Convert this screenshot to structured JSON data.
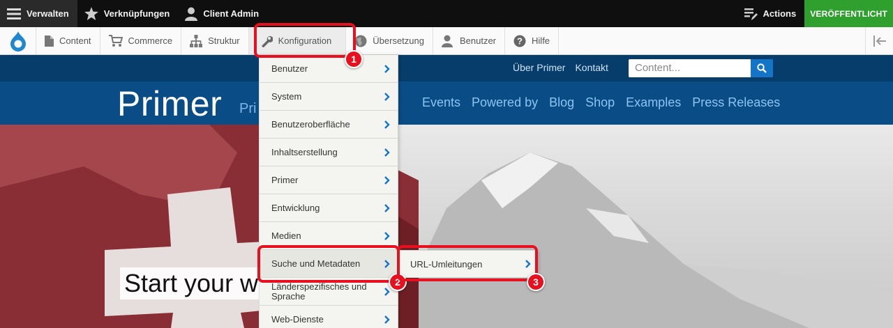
{
  "toolbar": {
    "manage_label": "Verwalten",
    "shortcuts_label": "Verknüpfungen",
    "user_label": "Client Admin",
    "actions_label": "Actions",
    "publish_label": "VERÖFFENTLICHT"
  },
  "tray": {
    "items": [
      {
        "label": "Content",
        "icon": "document-icon"
      },
      {
        "label": "Commerce",
        "icon": "cart-icon"
      },
      {
        "label": "Struktur",
        "icon": "sitemap-icon"
      },
      {
        "label": "Konfiguration",
        "icon": "wrench-icon"
      },
      {
        "label": "Übersetzung",
        "icon": "globe-icon"
      },
      {
        "label": "Benutzer",
        "icon": "person-icon"
      },
      {
        "label": "Hilfe",
        "icon": "question-icon"
      }
    ]
  },
  "site": {
    "top_links": [
      "Über Primer",
      "Kontakt"
    ],
    "search_placeholder": "Content...",
    "title": "Primer",
    "slogan": "Pri",
    "nav": [
      "Events",
      "Powered by",
      "Blog",
      "Shop",
      "Examples",
      "Press Releases"
    ],
    "hero_text": "Start your w"
  },
  "dropdown": {
    "items": [
      "Benutzer",
      "System",
      "Benutzeroberfläche",
      "Inhaltserstellung",
      "Primer",
      "Entwicklung",
      "Medien",
      "Suche und Metadaten",
      "Länderspezifisches und Sprache",
      "Web-Dienste"
    ]
  },
  "submenu": {
    "item": "URL-Umleitungen"
  },
  "annotations": {
    "step1": "1",
    "step2": "2",
    "step3": "3"
  },
  "colors": {
    "accent_red": "#e8101e",
    "publish_green": "#2fa02e",
    "site_blue": "#0a4c86",
    "link_blue": "#1475c7"
  }
}
